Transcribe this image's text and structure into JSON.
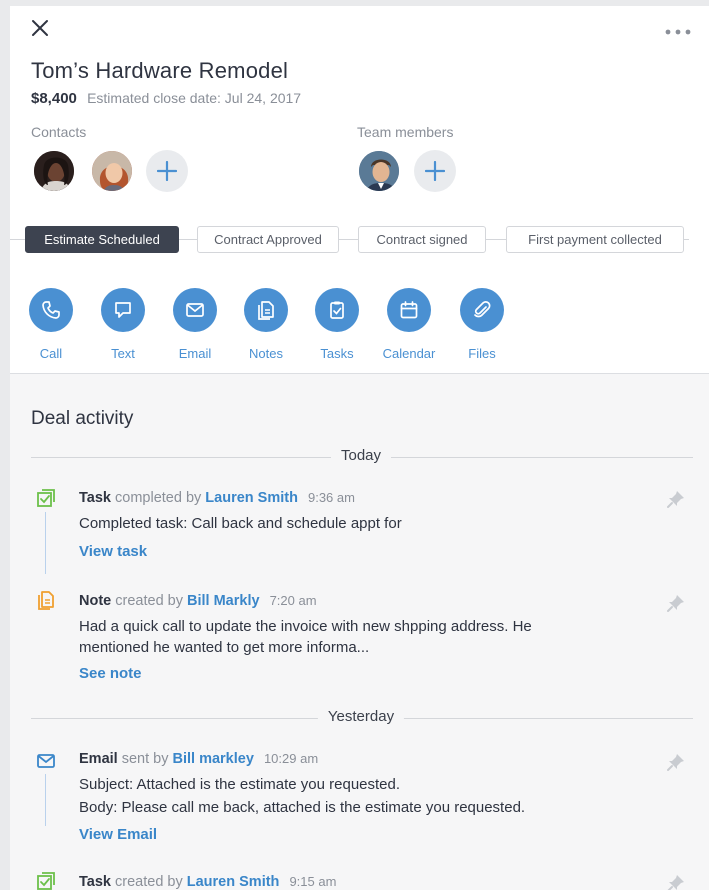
{
  "deal": {
    "title": "Tom’s Hardware Remodel",
    "amount": "$8,400",
    "close_date": "Estimated close date: Jul 24, 2017"
  },
  "contacts": {
    "label": "Contacts"
  },
  "team": {
    "label": "Team members"
  },
  "stages": [
    {
      "label": "Estimate Scheduled",
      "active": true
    },
    {
      "label": "Contract Approved",
      "active": false
    },
    {
      "label": "Contract signed",
      "active": false
    },
    {
      "label": "First payment collected",
      "active": false
    }
  ],
  "actions": [
    {
      "label": "Call",
      "icon": "phone-icon"
    },
    {
      "label": "Text",
      "icon": "chat-bubble-icon"
    },
    {
      "label": "Email",
      "icon": "envelope-icon"
    },
    {
      "label": "Notes",
      "icon": "note-icon"
    },
    {
      "label": "Tasks",
      "icon": "clipboard-check-icon"
    },
    {
      "label": "Calendar",
      "icon": "calendar-icon"
    },
    {
      "label": "Files",
      "icon": "paperclip-icon"
    }
  ],
  "activity": {
    "title": "Deal activity",
    "groups": [
      {
        "label": "Today"
      },
      {
        "label": "Yesterday"
      }
    ],
    "entries": [
      {
        "type": "Task",
        "verb": "completed by",
        "person": "Lauren Smith",
        "time": "9:36 am",
        "body": "Completed task: Call back and schedule appt for",
        "link": "View task",
        "icon": "task-check-icon",
        "color": "#6cc04a"
      },
      {
        "type": "Note",
        "verb": "created by",
        "person": "Bill Markly",
        "time": "7:20 am",
        "body": "Had a quick call to update the invoice with new shpping address. He mentioned he wanted to get more informa...",
        "link": "See note",
        "icon": "note-icon",
        "color": "#f0a030"
      },
      {
        "type": "Email",
        "verb": "sent by",
        "person": "Bill markley",
        "time": "10:29 am",
        "body_line1": "Subject: Attached is the estimate you requested.",
        "body_line2": "Body: Please call me back, attached is the estimate you requested.",
        "link": "View Email",
        "icon": "envelope-icon",
        "color": "#3a86c9"
      },
      {
        "type": "Task",
        "verb": "created by",
        "person": "Lauren Smith",
        "time": "9:15 am",
        "icon": "task-check-icon",
        "color": "#6cc04a"
      }
    ]
  },
  "colors": {
    "accent": "#4a90d2",
    "link": "#3a86c9",
    "active_stage": "#3d4350"
  }
}
